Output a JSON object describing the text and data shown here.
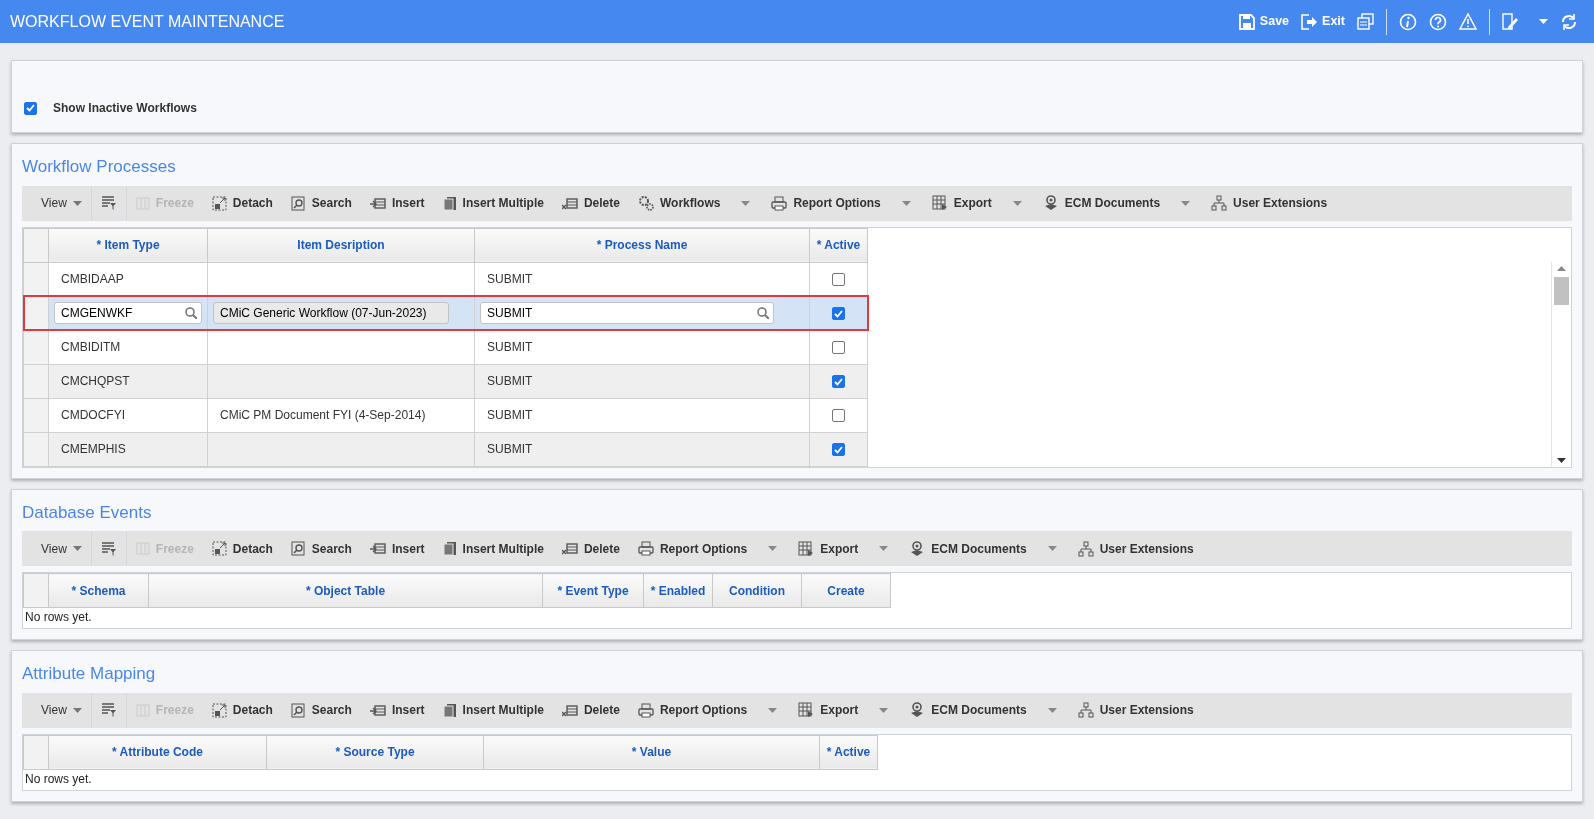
{
  "window": {
    "title": "WORKFLOW EVENT MAINTENANCE",
    "actions": [
      {
        "kind": "save",
        "label": "Save"
      },
      {
        "kind": "exit",
        "label": "Exit"
      }
    ]
  },
  "filter": {
    "label": "Show Inactive Workflows",
    "checked": true
  },
  "sections": [
    {
      "title": "Workflow Processes",
      "toolbar": [
        {
          "kind": "view",
          "label": "View",
          "dropdown": true,
          "disabled": false
        },
        {
          "kind": "filter",
          "dropdown": false,
          "disabled": false
        },
        {
          "kind": "freeze",
          "label": "Freeze",
          "dropdown": false,
          "disabled": true
        },
        {
          "kind": "detach",
          "label": "Detach",
          "dropdown": false,
          "disabled": false
        },
        {
          "kind": "search",
          "label": "Search",
          "dropdown": false,
          "disabled": false
        },
        {
          "kind": "insert",
          "label": "Insert",
          "dropdown": false,
          "disabled": false
        },
        {
          "kind": "insert-multiple",
          "label": "Insert Multiple",
          "dropdown": false,
          "disabled": false
        },
        {
          "kind": "delete",
          "label": "Delete",
          "dropdown": false,
          "disabled": false
        },
        {
          "kind": "workflows",
          "label": "Workflows",
          "dropdown": true,
          "disabled": false
        },
        {
          "kind": "report",
          "label": "Report Options",
          "dropdown": true,
          "disabled": false
        },
        {
          "kind": "export",
          "label": "Export",
          "dropdown": true,
          "disabled": false
        },
        {
          "kind": "ecm",
          "label": "ECM Documents",
          "dropdown": true,
          "disabled": false
        },
        {
          "kind": "extensions",
          "label": "User Extensions",
          "dropdown": false,
          "disabled": false
        }
      ],
      "table": {
        "columns": [
          "* Item Type",
          "Item Desription",
          "* Process Name",
          "* Active"
        ],
        "rows": [
          {
            "item_type": "CMBIDAAP",
            "description": "",
            "process_name": "SUBMIT",
            "active": false,
            "selected": false
          },
          {
            "item_type": "CMGENWKF",
            "description": "CMiC Generic Workflow (07-Jun-2023)",
            "process_name": "SUBMIT",
            "active": true,
            "selected": true
          },
          {
            "item_type": "CMBIDITM",
            "description": "",
            "process_name": "SUBMIT",
            "active": false,
            "selected": false
          },
          {
            "item_type": "CMCHQPST",
            "description": "",
            "process_name": "SUBMIT",
            "active": true,
            "selected": false
          },
          {
            "item_type": "CMDOCFYI",
            "description": "CMiC PM Document FYI (4-Sep-2014)",
            "process_name": "SUBMIT",
            "active": false,
            "selected": false
          },
          {
            "item_type": "CMEMPHIS",
            "description": "",
            "process_name": "SUBMIT",
            "active": true,
            "selected": false
          }
        ]
      }
    },
    {
      "title": "Database Events",
      "toolbar": [
        {
          "kind": "view",
          "label": "View",
          "dropdown": true,
          "disabled": false
        },
        {
          "kind": "filter",
          "dropdown": false,
          "disabled": false
        },
        {
          "kind": "freeze",
          "label": "Freeze",
          "dropdown": false,
          "disabled": true
        },
        {
          "kind": "detach",
          "label": "Detach",
          "dropdown": false,
          "disabled": false
        },
        {
          "kind": "search",
          "label": "Search",
          "dropdown": false,
          "disabled": false
        },
        {
          "kind": "insert",
          "label": "Insert",
          "dropdown": false,
          "disabled": false
        },
        {
          "kind": "insert-multiple",
          "label": "Insert Multiple",
          "dropdown": false,
          "disabled": false
        },
        {
          "kind": "delete",
          "label": "Delete",
          "dropdown": false,
          "disabled": false
        },
        {
          "kind": "report",
          "label": "Report Options",
          "dropdown": true,
          "disabled": false
        },
        {
          "kind": "export",
          "label": "Export",
          "dropdown": true,
          "disabled": false
        },
        {
          "kind": "ecm",
          "label": "ECM Documents",
          "dropdown": true,
          "disabled": false
        },
        {
          "kind": "extensions",
          "label": "User Extensions",
          "dropdown": false,
          "disabled": false
        }
      ],
      "table": {
        "columns": [
          "* Schema",
          "* Object Table",
          "* Event Type",
          "* Enabled",
          "Condition",
          "Create"
        ],
        "empty_text": "No rows yet."
      }
    },
    {
      "title": "Attribute Mapping",
      "toolbar": [
        {
          "kind": "view",
          "label": "View",
          "dropdown": true,
          "disabled": false
        },
        {
          "kind": "filter",
          "dropdown": false,
          "disabled": false
        },
        {
          "kind": "freeze",
          "label": "Freeze",
          "dropdown": false,
          "disabled": true
        },
        {
          "kind": "detach",
          "label": "Detach",
          "dropdown": false,
          "disabled": false
        },
        {
          "kind": "search",
          "label": "Search",
          "dropdown": false,
          "disabled": false
        },
        {
          "kind": "insert",
          "label": "Insert",
          "dropdown": false,
          "disabled": false
        },
        {
          "kind": "insert-multiple",
          "label": "Insert Multiple",
          "dropdown": false,
          "disabled": false
        },
        {
          "kind": "delete",
          "label": "Delete",
          "dropdown": false,
          "disabled": false
        },
        {
          "kind": "report",
          "label": "Report Options",
          "dropdown": true,
          "disabled": false
        },
        {
          "kind": "export",
          "label": "Export",
          "dropdown": true,
          "disabled": false
        },
        {
          "kind": "ecm",
          "label": "ECM Documents",
          "dropdown": true,
          "disabled": false
        },
        {
          "kind": "extensions",
          "label": "User Extensions",
          "dropdown": false,
          "disabled": false
        }
      ],
      "table": {
        "columns": [
          "* Attribute Code",
          "* Source Type",
          "* Value",
          "* Active"
        ],
        "empty_text": "No rows yet."
      }
    }
  ]
}
